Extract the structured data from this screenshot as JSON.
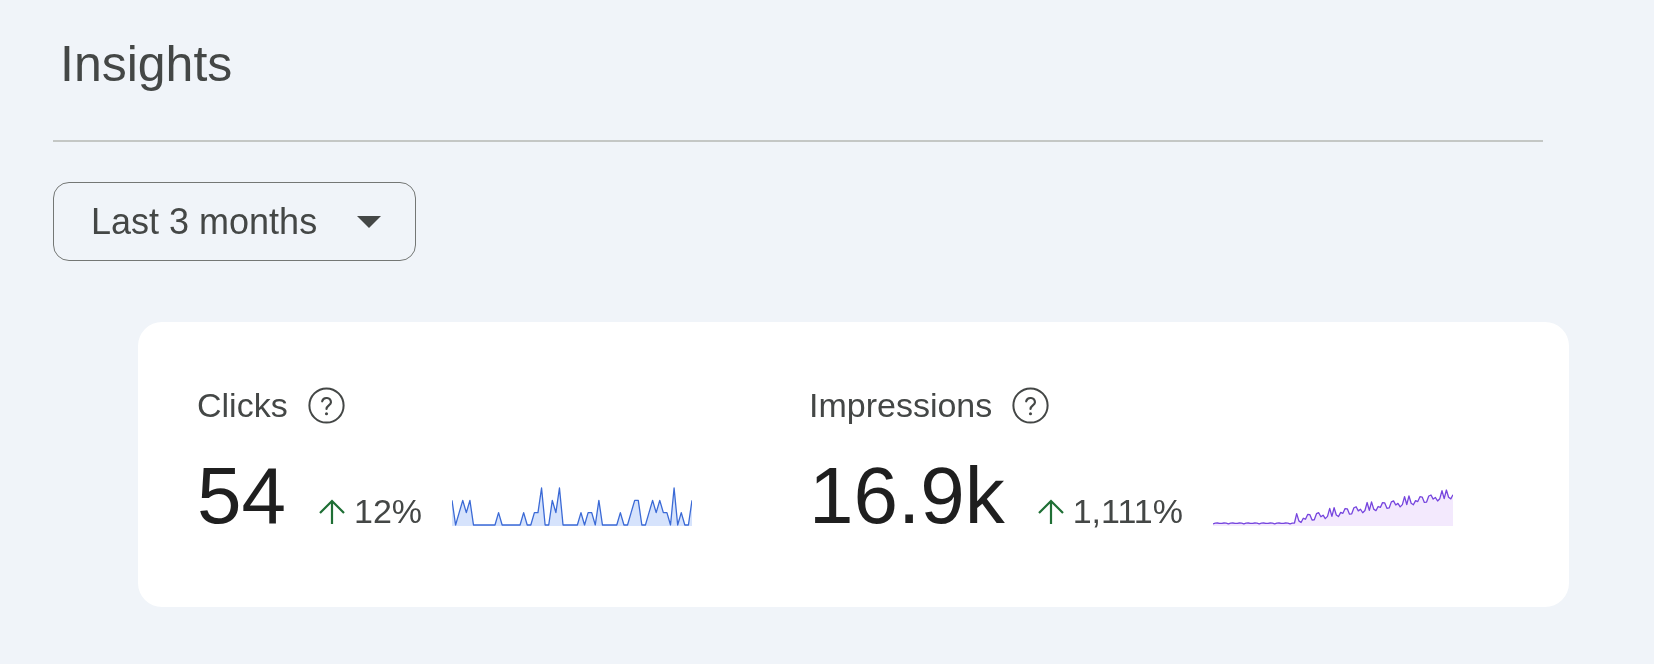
{
  "page": {
    "title": "Insights"
  },
  "date_range": {
    "value": "Last 3 months"
  },
  "metrics": [
    {
      "label": "Clicks",
      "value": "54",
      "change": {
        "rising": true,
        "text": "12%"
      }
    },
    {
      "label": "Impressions",
      "value": "16.9k",
      "change": {
        "rising": true,
        "text": "1,111%"
      }
    }
  ]
}
